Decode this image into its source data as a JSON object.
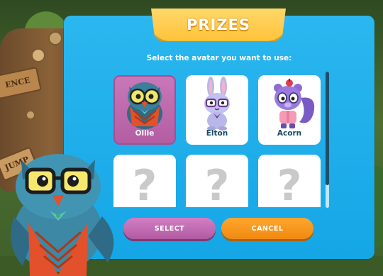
{
  "dialog": {
    "title": "PRIZES",
    "subtitle": "Select the avatar you want to use:"
  },
  "background": {
    "sign_top": "ENCE",
    "sign_bottom": "JUMP"
  },
  "avatars": [
    {
      "name": "Ollie",
      "icon": "owl-avatar-icon",
      "selected": true
    },
    {
      "name": "Elton",
      "icon": "bunny-avatar-icon",
      "selected": false
    },
    {
      "name": "Acorn",
      "icon": "squirrel-avatar-icon",
      "selected": false
    },
    {
      "name": "",
      "icon": "question-mark-icon",
      "locked": true,
      "glyph": "?"
    },
    {
      "name": "",
      "icon": "question-mark-icon",
      "locked": true,
      "glyph": "?"
    },
    {
      "name": "",
      "icon": "question-mark-icon",
      "locked": true,
      "glyph": "?"
    }
  ],
  "buttons": {
    "select_label": "SELECT",
    "cancel_label": "CANCEL"
  },
  "colors": {
    "panel": "#1aa9e8",
    "ribbon": "#ffc23a",
    "selected_card": "#b960a7",
    "select_button": "#b05aa2",
    "cancel_button": "#f08a11"
  }
}
